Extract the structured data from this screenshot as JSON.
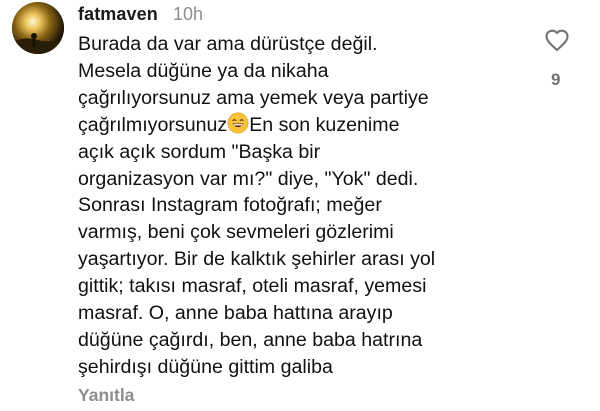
{
  "comment": {
    "username": "fatmaven",
    "time": "10h",
    "text_part1": "Burada da var ama dürüstçe değil.\nMesela düğüne ya da nikaha\nçağrılıyorsunuz ama yemek veya partiye\nçağrılmıyorsunuz",
    "emoji": "grinning-face-with-smiling-eyes",
    "text_part2": "En son kuzenime\naçık açık sordum \"Başka bir\norganizasyon var mı?\" diye, \"Yok\" dedi.\nSonrası Instagram fotoğrafı; meğer\nvarmış, beni çok sevmeleri gözlerimi\nyaşartıyor. Bir de kalktık şehirler arası yol\ngittik; takısı masraf, oteli masraf, yemesi\nmasraf. O, anne baba hattına arayıp\ndüğüne çağırdı, ben, anne baba hatrına\nşehirdışı düğüne gittim galiba",
    "like_count": "9",
    "reply_label": "Yanıtla",
    "like_icon": "heart-outline-icon"
  },
  "colors": {
    "username": "#1a1a1a",
    "meta": "#8e8e8e",
    "text": "#111111"
  }
}
